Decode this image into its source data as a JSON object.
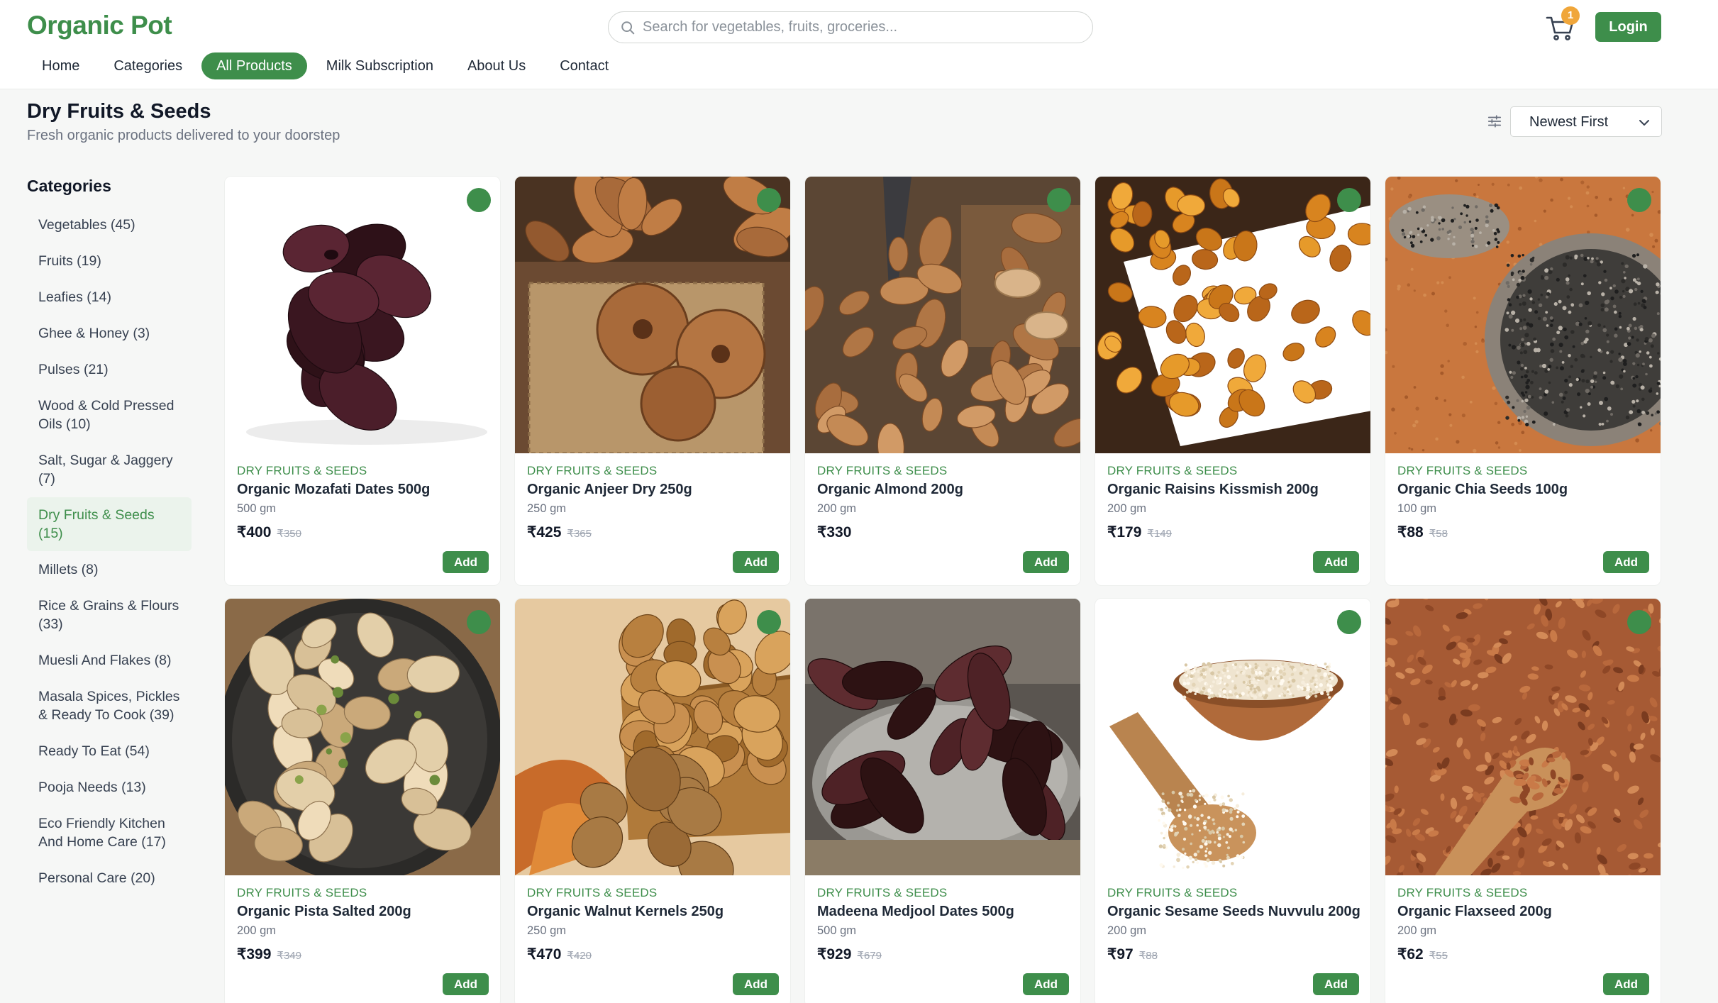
{
  "header": {
    "brand": "Organic Pot",
    "search_placeholder": "Search for vegetables, fruits, groceries...",
    "cart_count": "1",
    "login_label": "Login"
  },
  "nav": [
    "Home",
    "Categories",
    "All Products",
    "Milk Subscription",
    "About Us",
    "Contact"
  ],
  "nav_active": "All Products",
  "page": {
    "title": "Dry Fruits & Seeds",
    "subtitle": "Fresh organic products delivered to your doorstep",
    "sort_value": "Newest First"
  },
  "sidebar": {
    "title": "Categories",
    "items": [
      "Vegetables (45)",
      "Fruits (19)",
      "Leafies (14)",
      "Ghee & Honey (3)",
      "Pulses (21)",
      "Wood & Cold Pressed Oils (10)",
      "Salt, Sugar & Jaggery (7)",
      "Dry Fruits & Seeds (15)",
      "Millets (8)",
      "Rice & Grains & Flours (33)",
      "Muesli And Flakes (8)",
      "Masala Spices, Pickles & Ready To Cook (39)",
      "Ready To Eat (54)",
      "Pooja Needs (13)",
      "Eco Friendly Kitchen And Home Care (17)",
      "Personal Care (20)"
    ],
    "active": "Dry Fruits & Seeds (15)"
  },
  "products": [
    {
      "category": "DRY FRUITS & SEEDS",
      "name": "Organic Mozafati Dates 500g",
      "weight": "500 gm",
      "price": "₹400",
      "mrp": "₹350",
      "image": "dark-dates",
      "badge": true
    },
    {
      "category": "DRY FRUITS & SEEDS",
      "name": "Organic Anjeer Dry 250g",
      "weight": "250 gm",
      "price": "₹425",
      "mrp": "₹365",
      "image": "dried-figs",
      "badge": true
    },
    {
      "category": "DRY FRUITS & SEEDS",
      "name": "Organic Almond 200g",
      "weight": "200 gm",
      "price": "₹330",
      "mrp": "",
      "image": "almonds",
      "badge": true
    },
    {
      "category": "DRY FRUITS & SEEDS",
      "name": "Organic Raisins Kissmish 200g",
      "weight": "200 gm",
      "price": "₹179",
      "mrp": "₹149",
      "image": "raisins",
      "badge": true
    },
    {
      "category": "DRY FRUITS & SEEDS",
      "name": "Organic Chia Seeds 100g",
      "weight": "100 gm",
      "price": "₹88",
      "mrp": "₹58",
      "image": "chia-seeds",
      "badge": true
    },
    {
      "category": "DRY FRUITS & SEEDS",
      "name": "Organic Pista Salted 200g",
      "weight": "200 gm",
      "price": "₹399",
      "mrp": "₹349",
      "image": "pistachios",
      "badge": true
    },
    {
      "category": "DRY FRUITS & SEEDS",
      "name": "Organic Walnut Kernels 250g",
      "weight": "250 gm",
      "price": "₹470",
      "mrp": "₹420",
      "image": "walnuts",
      "badge": true
    },
    {
      "category": "DRY FRUITS & SEEDS",
      "name": "Madeena Medjool Dates 500g",
      "weight": "500 gm",
      "price": "₹929",
      "mrp": "₹679",
      "image": "medjool-dates",
      "badge": false
    },
    {
      "category": "DRY FRUITS & SEEDS",
      "name": "Organic Sesame Seeds Nuvvulu 200g",
      "weight": "200 gm",
      "price": "₹97",
      "mrp": "₹88",
      "image": "sesame-seeds",
      "badge": true
    },
    {
      "category": "DRY FRUITS & SEEDS",
      "name": "Organic Flaxseed 200g",
      "weight": "200 gm",
      "price": "₹62",
      "mrp": "₹55",
      "image": "flaxseed",
      "badge": true
    }
  ],
  "add_label": "Add",
  "colors": {
    "brand_green": "#3e8e4b",
    "badge_orange": "#f0a63a",
    "active_bg": "#ebf3ec",
    "page_bg": "#f6f7f6"
  }
}
